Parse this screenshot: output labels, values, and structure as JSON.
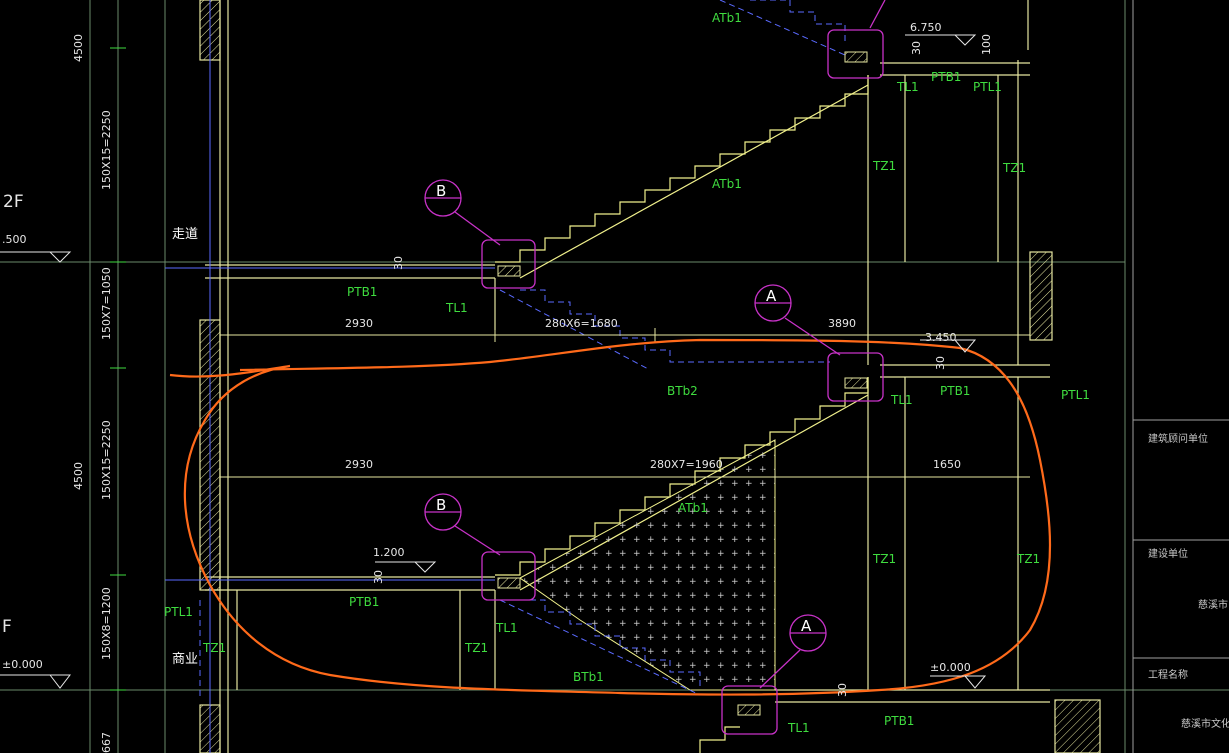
{
  "colors": {
    "background": "#000000",
    "wall": "#e6e6a0",
    "stair": "#f0f08c",
    "label_green": "#3fdc3f",
    "dim_text": "#e6e6e6",
    "callout": "#c832c8",
    "axis_line": "#6a8a6a",
    "markup": "#ff6a1a",
    "dashed": "#5a6aff"
  },
  "left_dims": {
    "d1": "4500",
    "d2": "150X15=2250",
    "d3": "150X7=1050",
    "d4": "4500",
    "d5": "150X15=2250",
    "d6": "150X8=1200",
    "d7": "667"
  },
  "floors": {
    "f2": "2F",
    "f2_elev": ".500",
    "f1": "F",
    "f1_elev": "±0.000"
  },
  "rooms": {
    "corridor": "走道",
    "shop": "商业"
  },
  "levels": {
    "l6750": "6.750",
    "l3450": "3.450",
    "l1200": "1.200",
    "l0000": "±0.000"
  },
  "thickness": {
    "t30a": "30",
    "t30b": "30",
    "t30c": "30",
    "t30d": "30",
    "t30e": "30",
    "t100": "100"
  },
  "dims": {
    "d2930a": "2930",
    "d2930b": "2930",
    "d280x6": "280X6=1680",
    "d280x7": "280X7=1960",
    "d3890": "3890",
    "d1650": "1650"
  },
  "labels": {
    "atb1_top": "ATb1",
    "atb1_mid": "ATb1",
    "atb1_low": "ATb1",
    "ptb1_tr": "PTB1",
    "ptl1_tr": "PTL1",
    "tl1_tr": "TL1",
    "tz1_a": "TZ1",
    "tz1_b": "TZ1",
    "ptb1_ml": "PTB1",
    "tl1_ml": "TL1",
    "btb2": "BTb2",
    "tl1_mr": "TL1",
    "ptb1_mr": "PTB1",
    "ptl1_r": "PTL1",
    "tz1_c": "TZ1",
    "tz1_d": "TZ1",
    "ptb1_ll": "PTB1",
    "ptl1_l": "PTL1",
    "tz1_l": "TZ1",
    "tl1_ll": "TL1",
    "tz1_ll": "TZ1",
    "btb1": "BTb1",
    "tl1_bot": "TL1",
    "ptb1_bot": "PTB1"
  },
  "callouts": {
    "b1": "B",
    "a1": "A",
    "b2": "B",
    "a2": "A"
  },
  "title_block": {
    "r1": "建筑顾问单位",
    "r2": "建设单位",
    "r2v": "慈溪市",
    "r3": "工程名称",
    "r3v": "慈溪市文化"
  }
}
